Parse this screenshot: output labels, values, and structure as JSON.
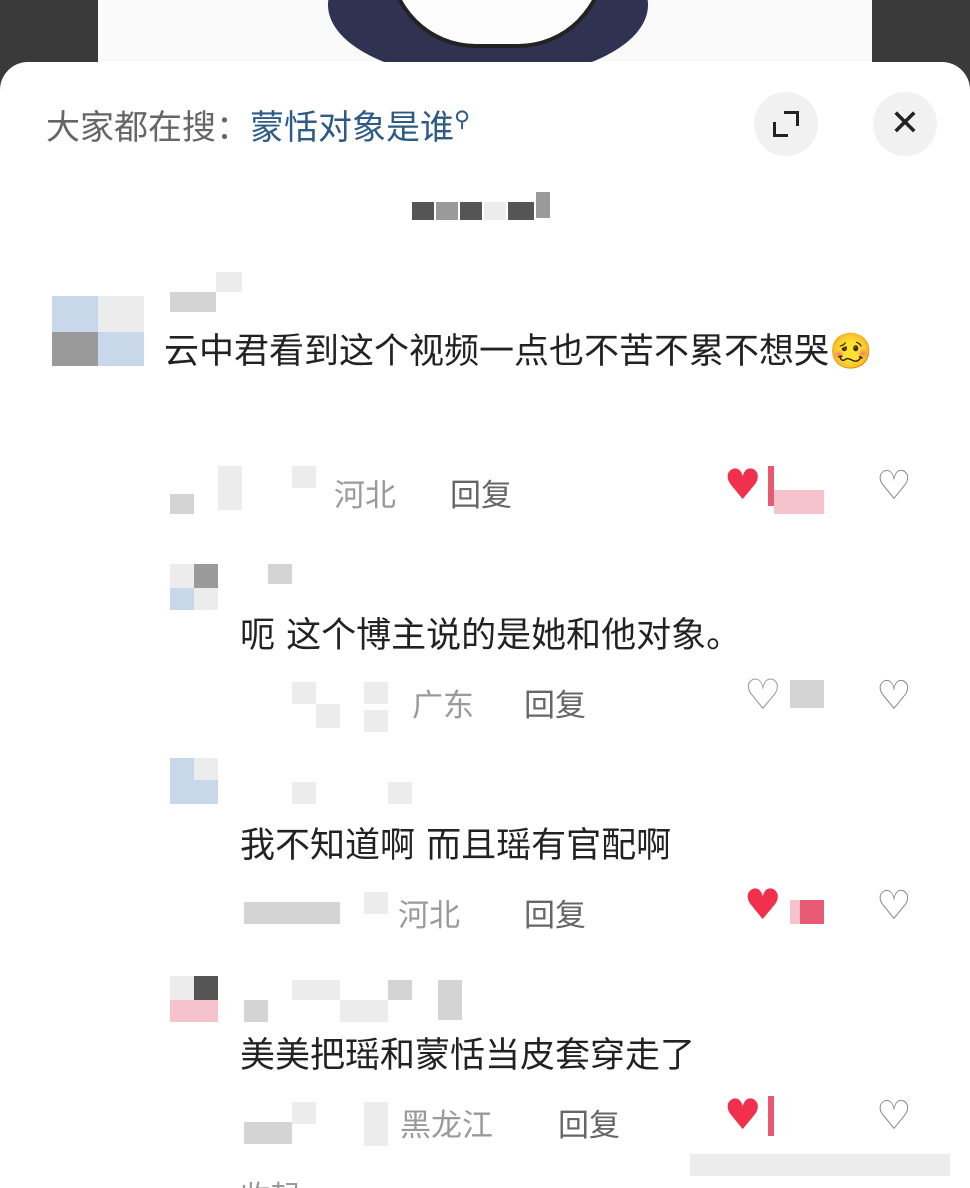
{
  "search": {
    "prefix": "大家都在搜：",
    "term": "蒙恬对象是谁"
  },
  "comments": [
    {
      "text": "云中君看到这个视频一点也不苦不累不想哭",
      "emoji": "🥴",
      "location": "河北",
      "reply_label": "回复",
      "liked": true
    },
    {
      "text": "呃 这个博主说的是她和他对象。",
      "location": "广东",
      "reply_label": "回复",
      "liked": false
    },
    {
      "text": "我不知道啊 而且瑶有官配啊",
      "location": "河北",
      "reply_label": "回复",
      "liked": true
    },
    {
      "text": "美美把瑶和蒙恬当皮套穿走了",
      "location": "黑龙江",
      "reply_label": "回复",
      "liked": true
    }
  ],
  "footer": {
    "collapse_label": "收起"
  },
  "colors": {
    "accent_link": "#2d5b86",
    "heart_red": "#f0304d"
  }
}
